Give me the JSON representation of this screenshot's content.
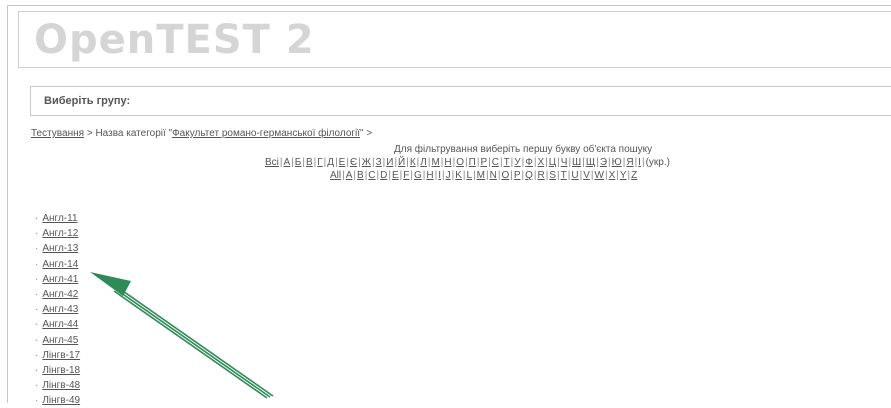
{
  "header": {
    "logo": "OpenTEST 2"
  },
  "group_selector": {
    "label": "Виберіть групу:"
  },
  "breadcrumb": {
    "root_link": "Тестування",
    "separator": ">",
    "category_prefix": "Назва категорії \"",
    "category_link": "Факультет романо-германської філології",
    "category_suffix": "\" >"
  },
  "filter": {
    "title": "Для фільтрування виберіть першу букву об'єкта пошуку",
    "ukrainian_letters": [
      "Всі",
      "А",
      "Б",
      "В",
      "Г",
      "Д",
      "Е",
      "Є",
      "Ж",
      "З",
      "И",
      "Й",
      "К",
      "Л",
      "М",
      "Н",
      "О",
      "П",
      "Р",
      "С",
      "Т",
      "У",
      "Ф",
      "Х",
      "Ц",
      "Ч",
      "Ш",
      "Щ",
      "Э",
      "Ю",
      "Я",
      "І"
    ],
    "ukrainian_suffix": "(укр.)",
    "latin_letters": [
      "All",
      "A",
      "B",
      "C",
      "D",
      "E",
      "F",
      "G",
      "H",
      "I",
      "J",
      "K",
      "L",
      "M",
      "N",
      "O",
      "P",
      "Q",
      "R",
      "S",
      "T",
      "U",
      "V",
      "W",
      "X",
      "Y",
      "Z"
    ]
  },
  "groups": [
    "Англ-11",
    "Англ-12",
    "Англ-13",
    "Англ-14",
    "Англ-41",
    "Англ-42",
    "Англ-43",
    "Англ-44",
    "Англ-45",
    "Лінгв-17",
    "Лінгв-18",
    "Лінгв-48",
    "Лінгв-49"
  ],
  "colors": {
    "arrow": "#2e8b57",
    "logo": "#d5d5d5",
    "link": "#555555"
  }
}
